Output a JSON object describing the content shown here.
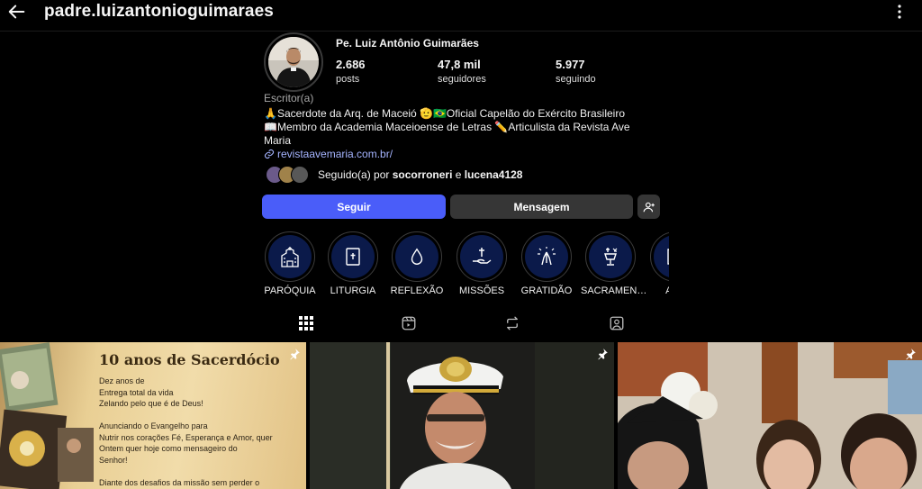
{
  "header": {
    "username": "padre.luizantonioguimaraes"
  },
  "profile": {
    "full_name": "Pe. Luiz Antônio Guimarães",
    "stats": [
      {
        "value": "2.686",
        "label": "posts"
      },
      {
        "value": "47,8 mil",
        "label": "seguidores"
      },
      {
        "value": "5.977",
        "label": "seguindo"
      }
    ],
    "category": "Escritor(a)",
    "bio_lines": [
      "🙏Sacerdote da Arq. de Maceió 🫡🇧🇷Oficial Capelão do Exército Brasileiro",
      "📖Membro da Academia Maceioense de Letras ✏️Articulista da Revista Ave",
      "Maria"
    ],
    "link": "revistaavemaria.com.br/",
    "followed_by_prefix": "Seguido(a) por ",
    "followed_by_user1": "socorroneri",
    "followed_by_conj": " e ",
    "followed_by_user2": "lucena4128"
  },
  "actions": {
    "follow_label": "Seguir",
    "message_label": "Mensagem"
  },
  "highlights": [
    {
      "label": "PARÓQUIA",
      "icon": "church-icon"
    },
    {
      "label": "LITURGIA",
      "icon": "bible-icon"
    },
    {
      "label": "REFLEXÃO",
      "icon": "drop-icon"
    },
    {
      "label": "MISSÕES",
      "icon": "hand-cross-icon"
    },
    {
      "label": "GRATIDÃO",
      "icon": "praying-hands-icon"
    },
    {
      "label": "SACRAMEN…",
      "icon": "chalice-icon"
    },
    {
      "label": "ART",
      "icon": "frame-icon"
    }
  ],
  "tabs": [
    {
      "name": "posts",
      "icon": "grid-icon"
    },
    {
      "name": "reels",
      "icon": "reels-icon"
    },
    {
      "name": "reposts",
      "icon": "repost-icon"
    },
    {
      "name": "tagged",
      "icon": "tagged-icon"
    }
  ],
  "posts": {
    "post1_title": "10 anos de Sacerdócio",
    "post1_text": "Dez anos de\nEntrega total da vida\nZelando pelo que é de Deus!\n\nAnunciando o Evangelho para\nNutrir nos corações Fé, Esperança e Amor, quer\nOntem quer hoje como mensageiro do\nSenhor!\n\nDiante dos desafios da missão sem perder o"
  },
  "colors": {
    "follow_button": "#4a5df9",
    "secondary_button": "#363636",
    "link": "#a5b4ff",
    "highlight_fill": "#0b1a4a"
  }
}
